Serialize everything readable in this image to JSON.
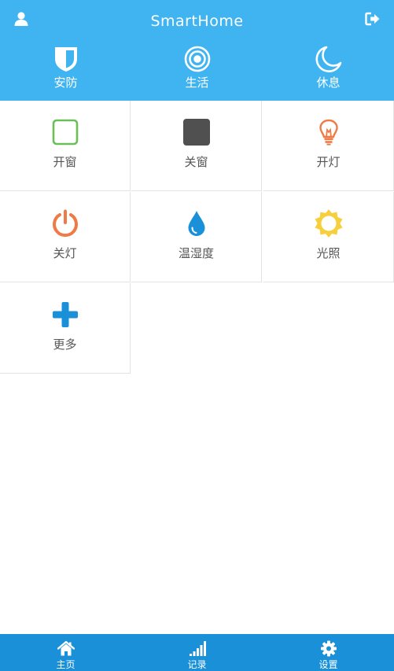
{
  "header": {
    "title": "SmartHome",
    "user_icon": "user-icon",
    "logout_icon": "logout-icon",
    "background": "#3fb4f1"
  },
  "modes": [
    {
      "label": "安防",
      "icon": "shield-icon"
    },
    {
      "label": "生活",
      "icon": "target-icon"
    },
    {
      "label": "休息",
      "icon": "moon-icon"
    }
  ],
  "tiles": [
    {
      "label": "开窗",
      "icon": "window-open-icon",
      "color": "#6bbf59"
    },
    {
      "label": "关窗",
      "icon": "window-closed-icon",
      "color": "#505050"
    },
    {
      "label": "开灯",
      "icon": "lightbulb-icon",
      "color": "#f07a45"
    },
    {
      "label": "关灯",
      "icon": "power-icon",
      "color": "#f07a45"
    },
    {
      "label": "温湿度",
      "icon": "water-drop-icon",
      "color": "#1a90d9"
    },
    {
      "label": "光照",
      "icon": "sun-icon",
      "color": "#f7cf3c"
    },
    {
      "label": "更多",
      "icon": "plus-icon",
      "color": "#1a90d9"
    }
  ],
  "tabbar": {
    "background": "#1a90d9",
    "tabs": [
      {
        "label": "主页",
        "icon": "home-icon"
      },
      {
        "label": "记录",
        "icon": "signal-bars-icon"
      },
      {
        "label": "设置",
        "icon": "gear-icon"
      }
    ]
  }
}
